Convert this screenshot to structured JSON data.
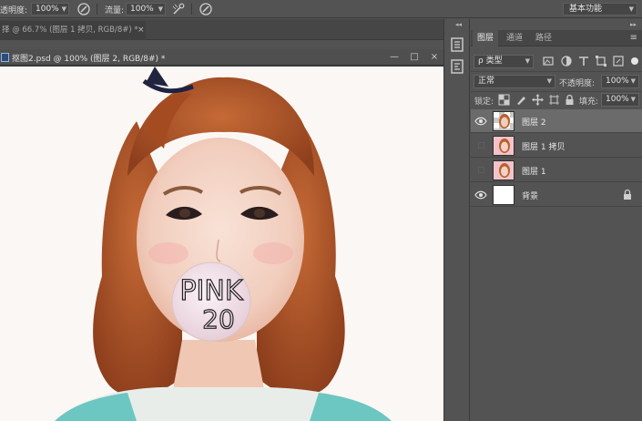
{
  "options_bar": {
    "opacity_label": "透明度:",
    "opacity_value": "100%",
    "flow_label": "流量:",
    "flow_value": "100%",
    "workspace": "基本功能",
    "icons": [
      "pressure-opacity-icon",
      "airbrush-icon",
      "pressure-size-icon"
    ]
  },
  "background_tab": {
    "title": "择 @ 66.7% (图层 1 拷贝, RGB/8#) *",
    "close": "×"
  },
  "document": {
    "title": "抠图2.psd @ 100% (图层 2, RGB/8#) *",
    "minimize": "—",
    "maximize": "□",
    "close": "×",
    "bubble_line1": "PINK",
    "bubble_line2": "20"
  },
  "layers_panel": {
    "tabs": [
      {
        "label": "图层",
        "active": true
      },
      {
        "label": "通道",
        "active": false
      },
      {
        "label": "路径",
        "active": false
      }
    ],
    "filter_value": "ρ 类型",
    "blend_mode": "正常",
    "opacity_label": "不透明度:",
    "opacity_value": "100%",
    "lock_label": "锁定:",
    "fill_label": "填充:",
    "fill_value": "100%",
    "layers": [
      {
        "name": "图层 2",
        "visible": true,
        "selected": true,
        "locked": false,
        "thumb": "photo"
      },
      {
        "name": "图层 1 拷贝",
        "visible": false,
        "selected": false,
        "locked": false,
        "thumb": "pink"
      },
      {
        "name": "图层 1",
        "visible": false,
        "selected": false,
        "locked": false,
        "thumb": "pink"
      },
      {
        "name": "背景",
        "visible": true,
        "selected": false,
        "locked": true,
        "thumb": "white"
      }
    ]
  },
  "colors": {
    "panel_bg": "#535353",
    "tab_bar_bg": "#464646",
    "selected_layer": "#6b6b6b",
    "hair": "#b4562a",
    "bubble": "#f1dfe6"
  }
}
